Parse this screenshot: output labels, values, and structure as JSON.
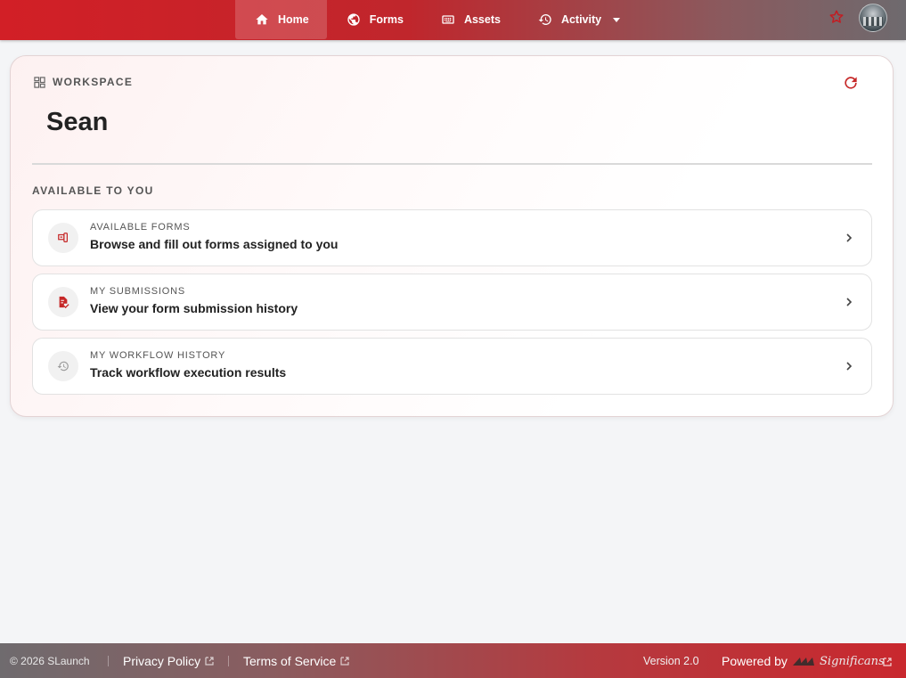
{
  "nav": {
    "items": [
      {
        "label": "Home",
        "icon": "home-icon",
        "active": true
      },
      {
        "label": "Forms",
        "icon": "globe-icon",
        "active": false
      },
      {
        "label": "Assets",
        "icon": "keyboard-icon",
        "active": false
      },
      {
        "label": "Activity",
        "icon": "history-icon",
        "active": false,
        "dropdown": true
      }
    ]
  },
  "workspace": {
    "label": "WORKSPACE",
    "user_name": "Sean",
    "section_title": "AVAILABLE TO YOU",
    "items": [
      {
        "kicker": "AVAILABLE FORMS",
        "title": "Browse and fill out forms assigned to you",
        "icon": "form-icon"
      },
      {
        "kicker": "MY SUBMISSIONS",
        "title": "View your form submission history",
        "icon": "document-check-icon"
      },
      {
        "kicker": "MY WORKFLOW HISTORY",
        "title": "Track workflow execution results",
        "icon": "history-icon"
      }
    ]
  },
  "footer": {
    "copyright": "© 2026 SLaunch",
    "privacy": "Privacy Policy",
    "terms": "Terms of Service",
    "version": "Version 2.0",
    "powered_by": "Powered by",
    "brand": "Significans"
  },
  "colors": {
    "accent": "#d21f26",
    "icon_red": "#c62828",
    "text_dark": "#222222",
    "text_muted": "#555555"
  }
}
